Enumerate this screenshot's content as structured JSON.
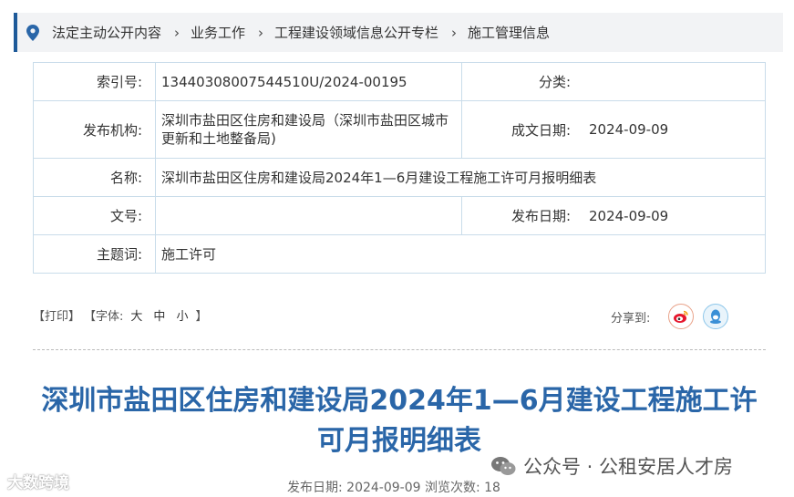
{
  "breadcrumb": {
    "items": [
      "法定主动公开内容",
      "业务工作",
      "工程建设领域信息公开专栏",
      "施工管理信息"
    ]
  },
  "meta": {
    "index_label": "索引号:",
    "index_value": "13440308007544510U/2024-00195",
    "category_label": "分类:",
    "category_value": "",
    "publisher_label": "发布机构:",
    "publisher_value": "深圳市盐田区住房和建设局（深圳市盐田区城市更新和土地整备局)",
    "created_label": "成文日期:",
    "created_value": "2024-09-09",
    "name_label": "名称:",
    "name_value": "深圳市盐田区住房和建设局2024年1—6月建设工程施工许可月报明细表",
    "docno_label": "文号:",
    "docno_value": "",
    "pubdate_label": "发布日期:",
    "pubdate_value": "2024-09-09",
    "topic_label": "主题词:",
    "topic_value": "施工许可"
  },
  "tools": {
    "print": "【打印】",
    "font_prefix": "【字体:",
    "font_large": "大",
    "font_medium": "中",
    "font_small": "小",
    "font_suffix": "】",
    "share_label": "分享到:"
  },
  "article": {
    "title": "深圳市盐田区住房和建设局2024年1—6月建设工程施工许可月报明细表",
    "footer": "发布日期:  2024-09-09   浏览次数:  18"
  },
  "watermarks": {
    "left": "大数跨境",
    "right": "公众号 · 公租安居人才房"
  },
  "colors": {
    "accent": "#1e5a99",
    "title": "#2a66a8",
    "table_border": "#c9dcea"
  },
  "icons": [
    "location-pin-icon",
    "chevron-right-icon",
    "weibo-icon",
    "qq-icon",
    "wechat-icon"
  ]
}
